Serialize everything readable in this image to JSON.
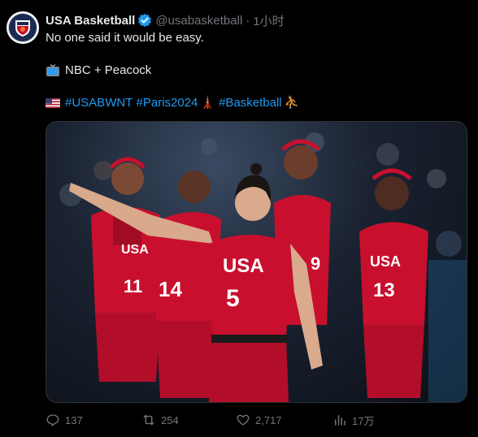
{
  "tweet": {
    "author_name": "USA Basketball",
    "handle": "@usabasketball",
    "separator": "·",
    "time": "1小时",
    "line1": "No one said it would be easy.",
    "line2": "NBC + Peacock",
    "hashtags": [
      "#USABWNT",
      "#Paris2024",
      "#Basketball"
    ],
    "emoji_tower": "🗼",
    "emoji_hoop": "⛹"
  },
  "media": {
    "jersey_text": "USA",
    "numbers": [
      "11",
      "14",
      "5",
      "9",
      "13"
    ]
  },
  "actions": {
    "replies": "137",
    "reposts": "254",
    "likes": "2,717",
    "views": "17万"
  },
  "colors": {
    "accent": "#1d9bf0",
    "muted": "#71767b",
    "jersey": "#c8102e"
  }
}
